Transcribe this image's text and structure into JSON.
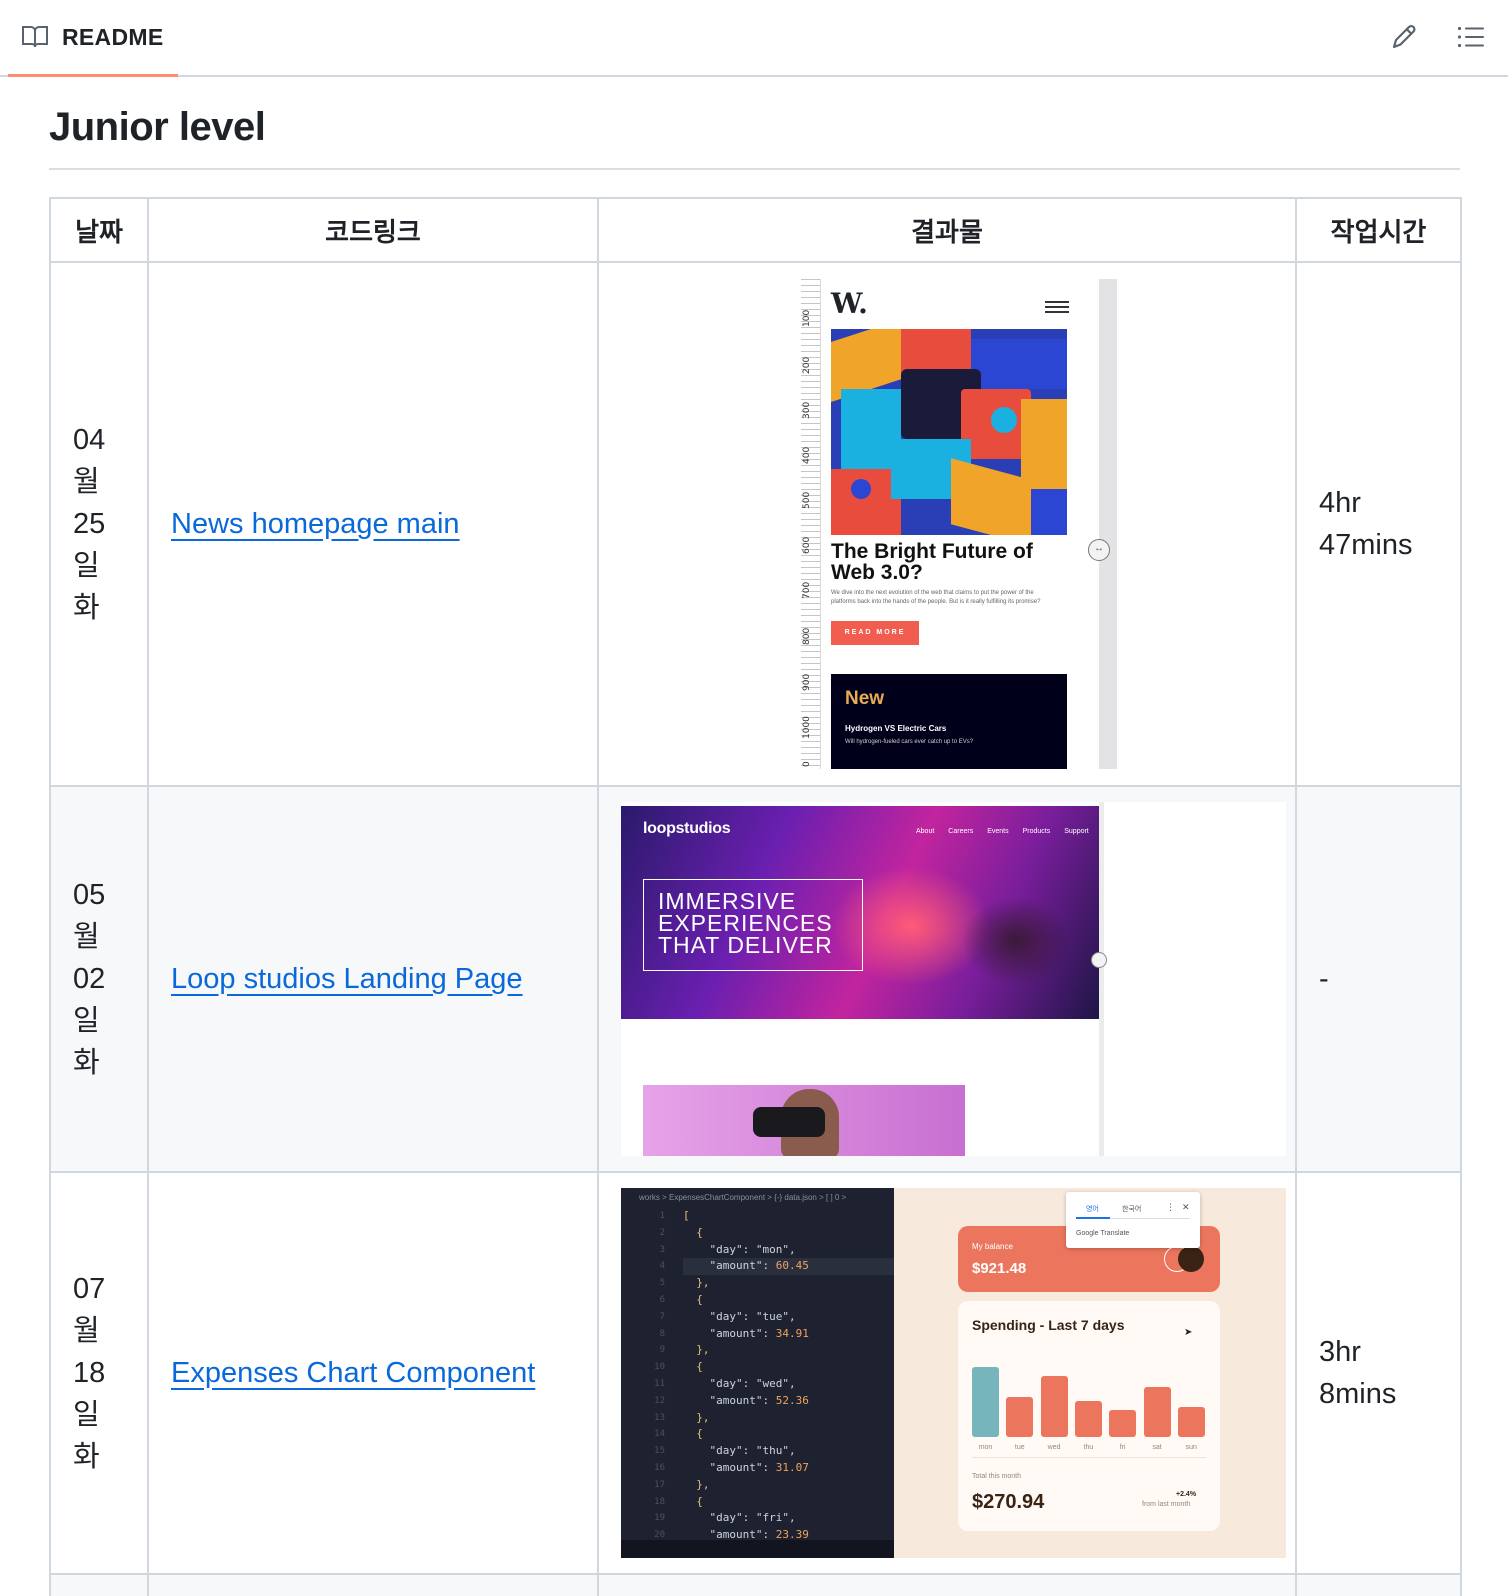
{
  "header": {
    "tab_label": "README",
    "edit_icon": "pencil-icon",
    "toc_icon": "list-icon",
    "accent": "#fd8c73"
  },
  "section": {
    "title": "Junior level"
  },
  "table": {
    "columns": [
      "날짜",
      "코드링크",
      "결과물",
      "작업시간"
    ],
    "rows": [
      {
        "date_lines": [
          "04",
          "월",
          "25",
          "일",
          "화"
        ],
        "link": "News homepage main",
        "time_lines": [
          "4hr",
          "47mins"
        ],
        "shot": {
          "logo": "W.",
          "headline": "The Bright Future of Web 3.0?",
          "blurb": "We dive into the next evolution of the web that claims to put the power of the platforms back into the hands of the people. But is it really fulfilling its promise?",
          "button": "READ MORE",
          "new_title": "New",
          "new_item": "Hydrogen VS Electric Cars",
          "new_desc": "Will hydrogen-fueled cars ever catch up to EVs?",
          "ruler": [
            "100",
            "200",
            "300",
            "400",
            "500",
            "600",
            "700",
            "800",
            "900",
            "1000",
            "0"
          ]
        }
      },
      {
        "date_lines": [
          "05",
          "월",
          "02",
          "일",
          "화"
        ],
        "link": "Loop studios Landing Page",
        "time_lines": [
          "-"
        ],
        "shot": {
          "brand": "loopstudios",
          "nav": [
            "About",
            "Careers",
            "Events",
            "Products",
            "Support"
          ],
          "hero_text": [
            "IMMERSIVE",
            "EXPERIENCES",
            "THAT DELIVER"
          ]
        }
      },
      {
        "date_lines": [
          "07",
          "월",
          "18",
          "일",
          "화"
        ],
        "link": "Expenses Chart Component",
        "time_lines": [
          "3hr",
          "8mins"
        ],
        "shot": {
          "breadcrumb": "works > ExpensesChartComponent > {-} data.json > [ ] 0 >",
          "code_lines": [
            "[",
            "  {",
            "    \"day\": \"mon\",",
            "    \"amount\": 60.45",
            "  },",
            "  {",
            "    \"day\": \"tue\",",
            "    \"amount\": 34.91",
            "  },",
            "  {",
            "    \"day\": \"wed\",",
            "    \"amount\": 52.36",
            "  },",
            "  {",
            "    \"day\": \"thu\",",
            "    \"amount\": 31.07",
            "  },",
            "  {",
            "    \"day\": \"fri\",",
            "    \"amount\": 23.39"
          ],
          "translate": {
            "tab1": "영어",
            "tab2": "한국어",
            "footer": "Google Translate",
            "menu": "⋮",
            "close": "✕"
          },
          "balance_label": "My balance",
          "balance_value": "$921.48",
          "chart_title": "Spending - Last 7 days",
          "total_label": "Total this month",
          "total_value": "$270.94",
          "change": "+2.4%",
          "change_label": "from last month"
        }
      },
      {
        "date_lines": [],
        "link": "",
        "time_lines": []
      }
    ]
  },
  "chart_data": {
    "type": "bar",
    "title": "Spending - Last 7 days",
    "categories": [
      "mon",
      "tue",
      "wed",
      "thu",
      "fri",
      "sat",
      "sun"
    ],
    "values": [
      60.45,
      34.91,
      52.36,
      31.07,
      23.39,
      43.28,
      25.48
    ],
    "highlight": "mon",
    "colors": {
      "bar": "#ec755d",
      "highlight": "#76b5bc"
    }
  }
}
